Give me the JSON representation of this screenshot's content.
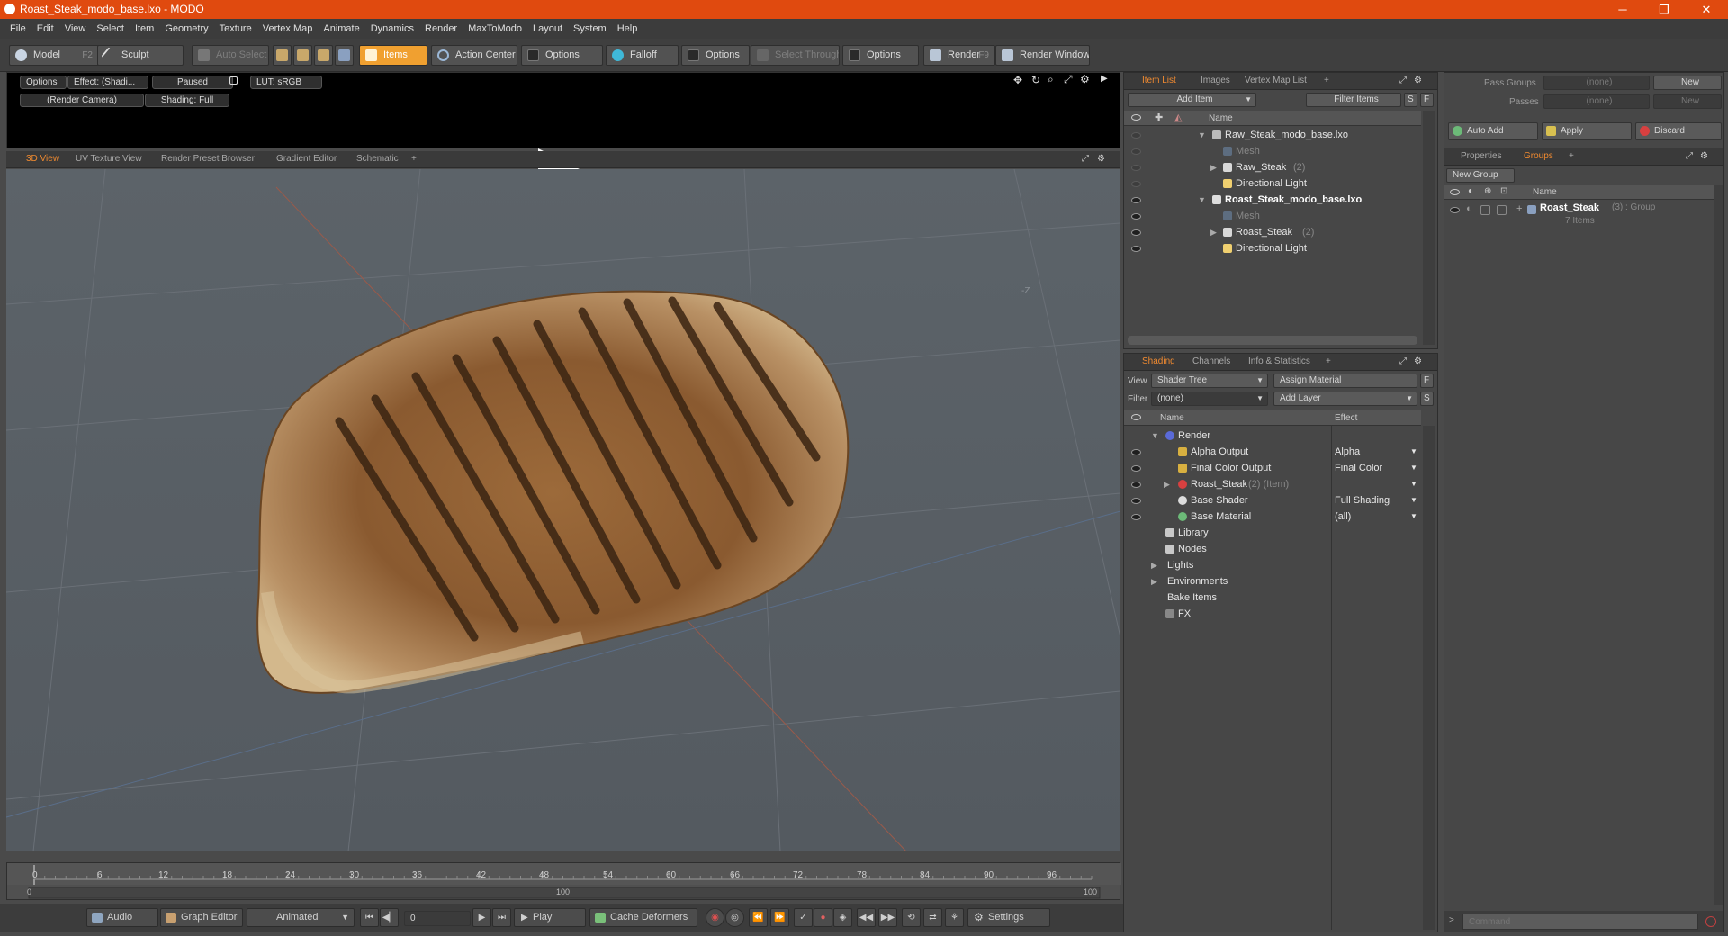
{
  "window": {
    "title": "Roast_Steak_modo_base.lxo - MODO",
    "minimize": "─",
    "maximize": "❐",
    "close": "✕"
  },
  "menu": [
    "File",
    "Edit",
    "View",
    "Select",
    "Item",
    "Geometry",
    "Texture",
    "Vertex Map",
    "Animate",
    "Dynamics",
    "Render",
    "MaxToModo",
    "Layout",
    "System",
    "Help"
  ],
  "toolbar": {
    "model": "Model",
    "model_key": "F2",
    "sculpt": "Sculpt",
    "auto_select": "Auto Select",
    "items": "Items",
    "action_center": "Action Center",
    "options1": "Options",
    "falloff": "Falloff",
    "options2": "Options",
    "select_through": "Select Through",
    "options3": "Options",
    "render": "Render",
    "render_key": "F9",
    "render_window": "Render Window"
  },
  "render_strip": {
    "options": "Options",
    "effect": "Effect: (Shadi...",
    "paused": "Paused",
    "lut": "LUT: sRGB",
    "camera": "(Render Camera)",
    "shading": "Shading: Full"
  },
  "view_tabs": [
    "3D View",
    "UV Texture View",
    "Render Preset Browser",
    "Gradient Editor",
    "Schematic"
  ],
  "viewport": {
    "axis_label": "-Z"
  },
  "timeline": {
    "ticks": [
      "0",
      "6",
      "12",
      "18",
      "24",
      "30",
      "36",
      "42",
      "48",
      "54",
      "60",
      "66",
      "72",
      "78",
      "84",
      "90",
      "96"
    ],
    "lower": [
      "0",
      "100",
      "100"
    ]
  },
  "bottom": {
    "audio": "Audio",
    "graph_editor": "Graph Editor",
    "animated": "Animated",
    "frame": "0",
    "play": "Play",
    "cache_deformers": "Cache Deformers",
    "settings": "Settings"
  },
  "item_list": {
    "tabs": [
      "Item List",
      "Images",
      "Vertex Map List"
    ],
    "add_item": "Add Item",
    "filter_items": "Filter Items",
    "s": "S",
    "f": "F",
    "col_name": "Name",
    "rows": [
      {
        "name": "Raw_Steak_modo_base.lxo",
        "suffix": ""
      },
      {
        "name": "Mesh",
        "suffix": ""
      },
      {
        "name": "Raw_Steak",
        "suffix": "(2)"
      },
      {
        "name": "Directional Light",
        "suffix": ""
      },
      {
        "name": "Roast_Steak_modo_base.lxo",
        "suffix": ""
      },
      {
        "name": "Mesh",
        "suffix": ""
      },
      {
        "name": "Roast_Steak",
        "suffix": "(2)"
      },
      {
        "name": "Directional Light",
        "suffix": ""
      }
    ]
  },
  "shading": {
    "tabs": [
      "Shading",
      "Channels",
      "Info & Statistics"
    ],
    "view_label": "View",
    "view_value": "Shader Tree",
    "assign_material": "Assign Material",
    "f": "F",
    "filter_label": "Filter",
    "filter_value": "(none)",
    "add_layer": "Add Layer",
    "s": "S",
    "col_name": "Name",
    "col_effect": "Effect",
    "rows": [
      {
        "name": "Render",
        "effect": "",
        "suffix": ""
      },
      {
        "name": "Alpha Output",
        "effect": "Alpha",
        "suffix": ""
      },
      {
        "name": "Final Color Output",
        "effect": "Final Color",
        "suffix": ""
      },
      {
        "name": "Roast_Steak",
        "effect": "",
        "suffix": "(2) (Item)"
      },
      {
        "name": "Base Shader",
        "effect": "Full Shading",
        "suffix": ""
      },
      {
        "name": "Base Material",
        "effect": "(all)",
        "suffix": ""
      },
      {
        "name": "Library",
        "effect": "",
        "suffix": ""
      },
      {
        "name": "Nodes",
        "effect": "",
        "suffix": ""
      },
      {
        "name": "Lights",
        "effect": "",
        "suffix": ""
      },
      {
        "name": "Environments",
        "effect": "",
        "suffix": ""
      },
      {
        "name": "Bake Items",
        "effect": "",
        "suffix": ""
      },
      {
        "name": "FX",
        "effect": "",
        "suffix": ""
      }
    ]
  },
  "groups_panel": {
    "pass_groups_label": "Pass Groups",
    "pass_groups_value": "(none)",
    "new1": "New",
    "passes_label": "Passes",
    "passes_value": "(none)",
    "new2": "New",
    "auto_add": "Auto Add",
    "apply": "Apply",
    "discard": "Discard",
    "tabs": [
      "Properties",
      "Groups"
    ],
    "new_group": "New Group",
    "col_name": "Name",
    "group_name": "Roast_Steak",
    "group_suffix": "(3) : Group",
    "group_items": "7 Items",
    "command_placeholder": "Command"
  }
}
